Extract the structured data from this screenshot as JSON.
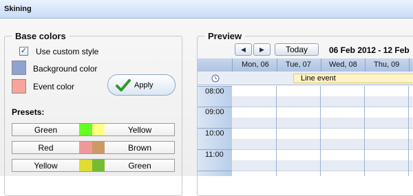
{
  "window": {
    "title": "Skining"
  },
  "base_colors": {
    "legend": "Base colors",
    "use_custom_style": {
      "label": "Use custom style",
      "checked": true
    },
    "background_color": {
      "label": "Background color",
      "color": "#8fa3d1"
    },
    "event_color": {
      "label": "Event color",
      "color": "#f7a49a"
    },
    "apply_label": "Apply",
    "presets_title": "Presets:",
    "presets": [
      {
        "name1": "Green",
        "name2": "Yellow",
        "color1": "#66ff22",
        "color2": "#ffff88"
      },
      {
        "name1": "Red",
        "name2": "Brown",
        "color1": "#ee9999",
        "color2": "#cc9966"
      },
      {
        "name1": "Yellow",
        "name2": "Green",
        "color1": "#dddd33",
        "color2": "#77bb33"
      }
    ]
  },
  "preview": {
    "legend": "Preview",
    "nav": {
      "prev_icon": "triangle-left",
      "next_icon": "triangle-right",
      "today_label": "Today"
    },
    "date_range": "06 Feb 2012 - 12 Feb",
    "days": [
      "Mon, 06",
      "Tue, 07",
      "Wed, 08",
      "Thu, 09"
    ],
    "all_day_event": "Line event",
    "times": [
      "08:00",
      "09:00",
      "10:00",
      "11:00"
    ],
    "accent_color": "#aec4e3"
  }
}
